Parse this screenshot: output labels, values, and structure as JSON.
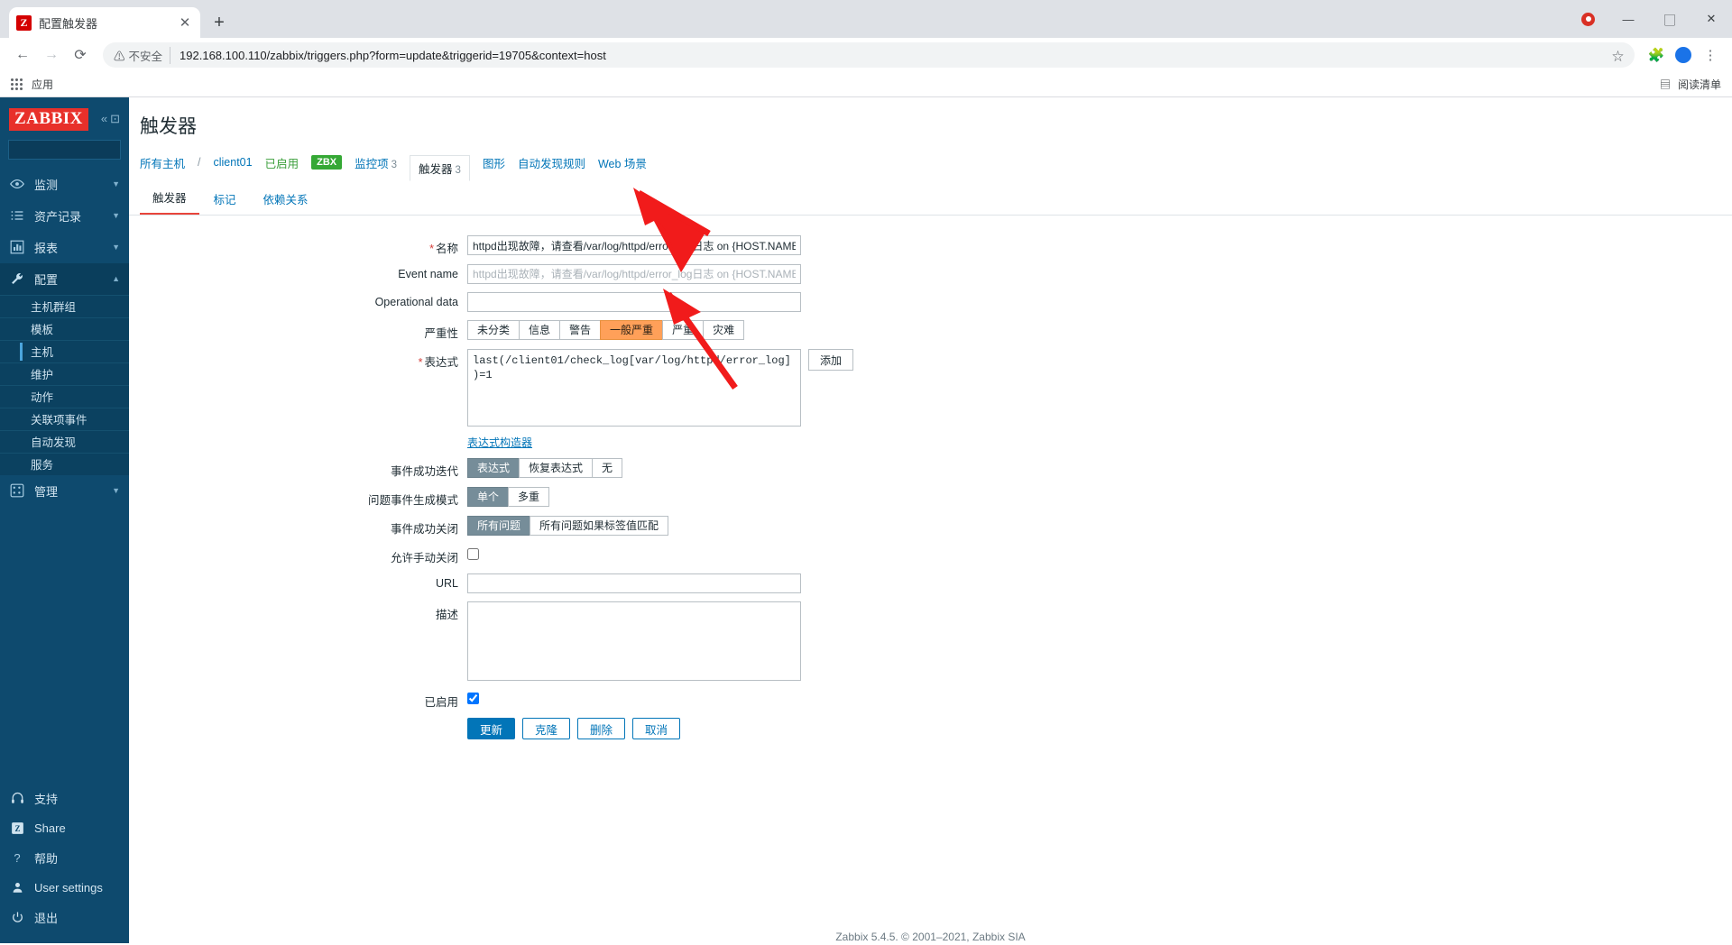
{
  "browser": {
    "tab_title": "配置触发器",
    "tab_favicon_letter": "Z",
    "close_tab_glyph": "✕",
    "newtab_glyph": "+",
    "back_glyph": "←",
    "forward_glyph": "→",
    "reload_glyph": "⟳",
    "not_secure_label": "不安全",
    "warning_glyph": "⚠",
    "url": "192.168.100.110/zabbix/triggers.php?form=update&triggerid=19705&context=host",
    "star_glyph": "☆",
    "extensions_glyph": "🧩",
    "menu_glyph": "⋮",
    "minimize_glyph": "—",
    "maximize_glyph": "▢",
    "close_glyph": "✕",
    "bookmarks_label": "应用",
    "reading_list_label": "阅读清单",
    "reading_list_glyph": "▤"
  },
  "sidebar": {
    "logo": "ZABBIX",
    "collapse_glyph": "«",
    "hide_glyph": "⊡",
    "search_placeholder": "",
    "search_glyph": "🔍",
    "items": [
      {
        "label": "监测",
        "icon": "eye-icon",
        "has_arrow": true,
        "active": false
      },
      {
        "label": "资产记录",
        "icon": "list-icon",
        "has_arrow": true,
        "active": false
      },
      {
        "label": "报表",
        "icon": "chart-icon",
        "has_arrow": true,
        "active": false
      },
      {
        "label": "配置",
        "icon": "wrench-icon",
        "has_arrow": true,
        "active": true
      }
    ],
    "submenu": [
      {
        "label": "主机群组",
        "selected": false
      },
      {
        "label": "模板",
        "selected": false
      },
      {
        "label": "主机",
        "selected": true
      },
      {
        "label": "维护",
        "selected": false
      },
      {
        "label": "动作",
        "selected": false
      },
      {
        "label": "关联项事件",
        "selected": false
      },
      {
        "label": "自动发现",
        "selected": false
      },
      {
        "label": "服务",
        "selected": false
      }
    ],
    "admin": {
      "label": "管理",
      "icon": "cog-grid-icon",
      "has_arrow": true
    },
    "bottom_items": [
      {
        "label": "支持",
        "icon": "headset-icon"
      },
      {
        "label": "Share",
        "icon": "zabbix-z-icon"
      },
      {
        "label": "帮助",
        "icon": "question-icon"
      },
      {
        "label": "User settings",
        "icon": "person-icon"
      },
      {
        "label": "退出",
        "icon": "power-icon"
      }
    ]
  },
  "page": {
    "title": "触发器",
    "breadcrumb": {
      "all_hosts": "所有主机",
      "separator": "/",
      "host": "client01",
      "status": "已启用",
      "agent_badge": "ZBX",
      "nav": [
        {
          "label": "监控项",
          "count": "3",
          "active": false
        },
        {
          "label": "触发器",
          "count": "3",
          "active": true
        },
        {
          "label": "图形",
          "count": "",
          "active": false
        },
        {
          "label": "自动发现规则",
          "count": "",
          "active": false
        },
        {
          "label": "Web 场景",
          "count": "",
          "active": false
        }
      ]
    },
    "tabs": [
      {
        "label": "触发器",
        "selected": true
      },
      {
        "label": "标记",
        "selected": false
      },
      {
        "label": "依赖关系",
        "selected": false
      }
    ]
  },
  "form": {
    "name": {
      "label": "名称",
      "required": true,
      "value": "httpd出现故障，请查看/var/log/httpd/error_log日志 on {HOST.NAME}"
    },
    "event_name": {
      "label": "Event name",
      "required": false,
      "value": "",
      "placeholder": "httpd出现故障，请查看/var/log/httpd/error_log日志 on {HOST.NAME}"
    },
    "operational_data": {
      "label": "Operational data",
      "required": false,
      "value": "",
      "placeholder": ""
    },
    "severity": {
      "label": "严重性",
      "options": [
        "未分类",
        "信息",
        "警告",
        "一般严重",
        "严重",
        "灾难"
      ],
      "selected": "一般严重",
      "selected_color": "#ffa059"
    },
    "expression": {
      "label": "表达式",
      "required": true,
      "value": "last(/client01/check_log[var/log/httpd/error_log])=1",
      "add_button": "添加",
      "constructor_link": "表达式构造器"
    },
    "recovery_mode": {
      "label": "事件成功迭代",
      "options": [
        "表达式",
        "恢复表达式",
        "无"
      ],
      "selected": "表达式"
    },
    "problem_generation_mode": {
      "label": "问题事件生成模式",
      "options": [
        "单个",
        "多重"
      ],
      "selected": "单个"
    },
    "ok_event_closes": {
      "label": "事件成功关闭",
      "options": [
        "所有问题",
        "所有问题如果标签值匹配"
      ],
      "selected": "所有问题"
    },
    "allow_manual_close": {
      "label": "允许手动关闭",
      "checked": false
    },
    "url": {
      "label": "URL",
      "value": "",
      "placeholder": ""
    },
    "description": {
      "label": "描述",
      "value": "",
      "placeholder": ""
    },
    "enabled": {
      "label": "已启用",
      "checked": true
    },
    "buttons": [
      {
        "label": "更新",
        "primary": true
      },
      {
        "label": "克隆",
        "primary": false
      },
      {
        "label": "删除",
        "primary": false
      },
      {
        "label": "取消",
        "primary": false
      }
    ]
  },
  "footer": {
    "text": "Zabbix 5.4.5. © 2001–2021, Zabbix SIA"
  }
}
